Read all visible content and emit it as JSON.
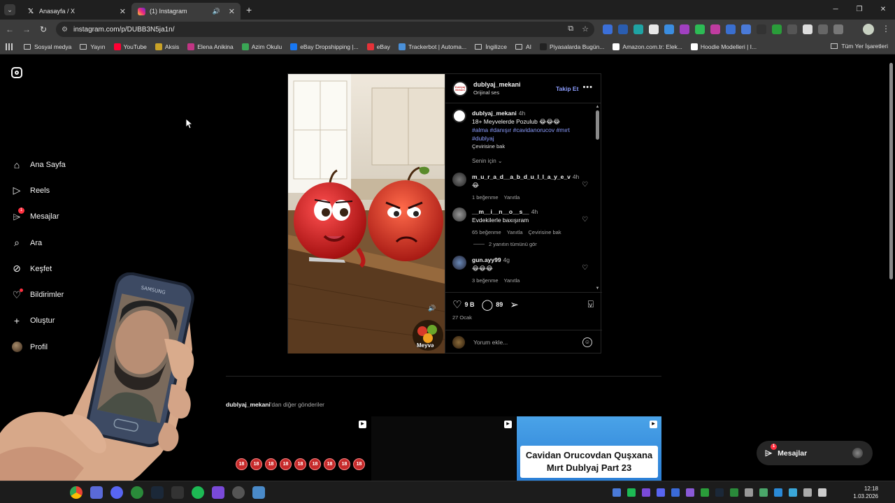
{
  "browser": {
    "tabs": [
      {
        "title": "Anasayfa / X"
      },
      {
        "title": "(1) Instagram"
      }
    ],
    "url": "instagram.com/p/DUBB3N5ja1n/",
    "bookmarks": [
      {
        "label": "Sosyal medya",
        "type": "folder"
      },
      {
        "label": "Yayın",
        "type": "folder"
      },
      {
        "label": "YouTube",
        "color": "#ff0033"
      },
      {
        "label": "Aksis",
        "color": "#c9a227"
      },
      {
        "label": "Elena Anikina",
        "color": "#c13584"
      },
      {
        "label": "Azim Okulu",
        "color": "#3aa655"
      },
      {
        "label": "eBay Dropshipping |...",
        "color": "#1877f2"
      },
      {
        "label": "eBay",
        "color": "#e53238"
      },
      {
        "label": "Trackerbot | Automa...",
        "color": "#4a90d9"
      },
      {
        "label": "İngilizce",
        "type": "folder"
      },
      {
        "label": "AI",
        "type": "folder"
      },
      {
        "label": "Piyasalarda Bugün...",
        "color": "#222222"
      },
      {
        "label": "Amazon.com.tr: Elek...",
        "color": "#ffffff"
      },
      {
        "label": "Hoodie Modelleri | I...",
        "color": "#ffffff"
      }
    ],
    "all_bookmarks": "Tüm Yer İşaretleri"
  },
  "sidebar": {
    "items": [
      {
        "label": "Ana Sayfa",
        "icon": "home-icon"
      },
      {
        "label": "Reels",
        "icon": "reels-icon"
      },
      {
        "label": "Mesajlar",
        "icon": "messages-icon",
        "badge": "1"
      },
      {
        "label": "Ara",
        "icon": "search-icon"
      },
      {
        "label": "Keşfet",
        "icon": "explore-icon"
      },
      {
        "label": "Bildirimler",
        "icon": "heart-icon"
      },
      {
        "label": "Oluştur",
        "icon": "plus-icon"
      },
      {
        "label": "Profil",
        "icon": "avatar"
      }
    ]
  },
  "post": {
    "author": "dublyaj_mekani",
    "audio": "Orijinal ses",
    "follow_label": "Takip Et",
    "caption": {
      "user": "dublyaj_mekani",
      "time": "4h",
      "text": "18+ Meyvelerde Pozulub 😂😂😂",
      "tags": "#alma #danışır #cavidanorucov #mırt #dublyaj",
      "see_translation": "Çevirisine bak"
    },
    "for_you": "Senin için",
    "comments": [
      {
        "user": "m_u_r_a_d__a_b_d_u_l_l_a_y_e_v",
        "time": "4h",
        "text": "😂",
        "likes": "1 beğenme",
        "reply": "Yanıtla",
        "translate": ""
      },
      {
        "user": "__m__i__n__o__s__",
        "time": "4h",
        "text": "Evdekilerle baxışıram",
        "likes": "65 beğenme",
        "reply": "Yanıtla",
        "translate": "Çevirisine bak"
      },
      {
        "user": "gun.ayy99",
        "time": "4g",
        "text": "😂😂😂",
        "likes": "3 beğenme",
        "reply": "Yanıtla",
        "translate": ""
      }
    ],
    "view_replies": "2 yanıtın tümünü gör",
    "like_count": "9 B",
    "comment_count": "89",
    "date": "27 Ocak",
    "add_comment_placeholder": "Yorum ekle...",
    "media_watermark": "Meyvə"
  },
  "more_posts": {
    "user": "dublyaj_mekani",
    "suffix": "'dan diğer gönderiler",
    "thumb3_title": "Cavidan Orucovdan Quşxana Mırt Dublyaj Part 23",
    "thumb1_badges": [
      "18",
      "18",
      "18",
      "18",
      "18",
      "18",
      "18",
      "18",
      "18"
    ]
  },
  "messages_pill": {
    "label": "Mesajlar",
    "badge": "1"
  },
  "clock": {
    "time": "12:18",
    "date": "1.03.2026"
  }
}
